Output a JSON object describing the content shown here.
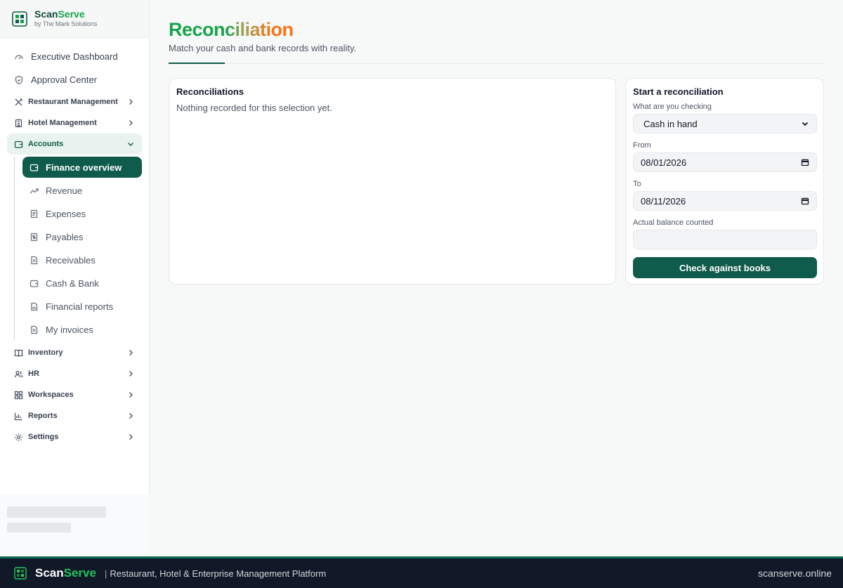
{
  "brand": {
    "name_part1": "Scan",
    "name_part2": "Serve",
    "subtitle": "by The Mark Solutions"
  },
  "sidebar": {
    "top_items": [
      {
        "label": "Executive Dashboard",
        "icon": "gauge-icon"
      },
      {
        "label": "Approval Center",
        "icon": "shield-check-icon"
      }
    ],
    "groups_before": [
      {
        "label": "Restaurant Management",
        "icon": "utensils-icon"
      },
      {
        "label": "Hotel Management",
        "icon": "building-icon"
      }
    ],
    "accounts": {
      "label": "Accounts",
      "icon": "wallet-icon",
      "items": [
        {
          "label": "Finance overview",
          "icon": "wallet-icon",
          "active": true
        },
        {
          "label": "Revenue",
          "icon": "trending-up-icon"
        },
        {
          "label": "Expenses",
          "icon": "receipt-icon"
        },
        {
          "label": "Payables",
          "icon": "dollar-receipt-icon"
        },
        {
          "label": "Receivables",
          "icon": "document-icon"
        },
        {
          "label": "Cash & Bank",
          "icon": "wallet-icon"
        },
        {
          "label": "Financial reports",
          "icon": "report-icon"
        },
        {
          "label": "My invoices",
          "icon": "document-icon"
        }
      ]
    },
    "groups_after": [
      {
        "label": "Inventory",
        "icon": "book-icon"
      },
      {
        "label": "HR",
        "icon": "users-icon"
      },
      {
        "label": "Workspaces",
        "icon": "grid-icon"
      },
      {
        "label": "Reports",
        "icon": "chart-icon"
      },
      {
        "label": "Settings",
        "icon": "gear-icon"
      }
    ]
  },
  "page": {
    "title": "Reconciliation",
    "subtitle": "Match your cash and bank records with reality."
  },
  "reconciliations": {
    "title": "Reconciliations",
    "empty_text": "Nothing recorded for this selection yet."
  },
  "form": {
    "title": "Start a reconciliation",
    "checking_label": "What are you checking",
    "checking_value": "Cash in hand",
    "from_label": "From",
    "from_value": "08/01/2026",
    "to_label": "To",
    "to_value": "08/11/2026",
    "balance_label": "Actual balance counted",
    "balance_value": "",
    "submit_label": "Check against books"
  },
  "footer": {
    "brand_part1": "Scan",
    "brand_part2": "Serve",
    "separator": "|",
    "tagline": "Restaurant, Hotel & Enterprise Management Platform",
    "url": "scanserve.online"
  },
  "colors": {
    "primary": "#0f5b4c",
    "accent_green": "#16a34a",
    "accent_orange": "#f97316",
    "footer_bg": "#111827"
  }
}
